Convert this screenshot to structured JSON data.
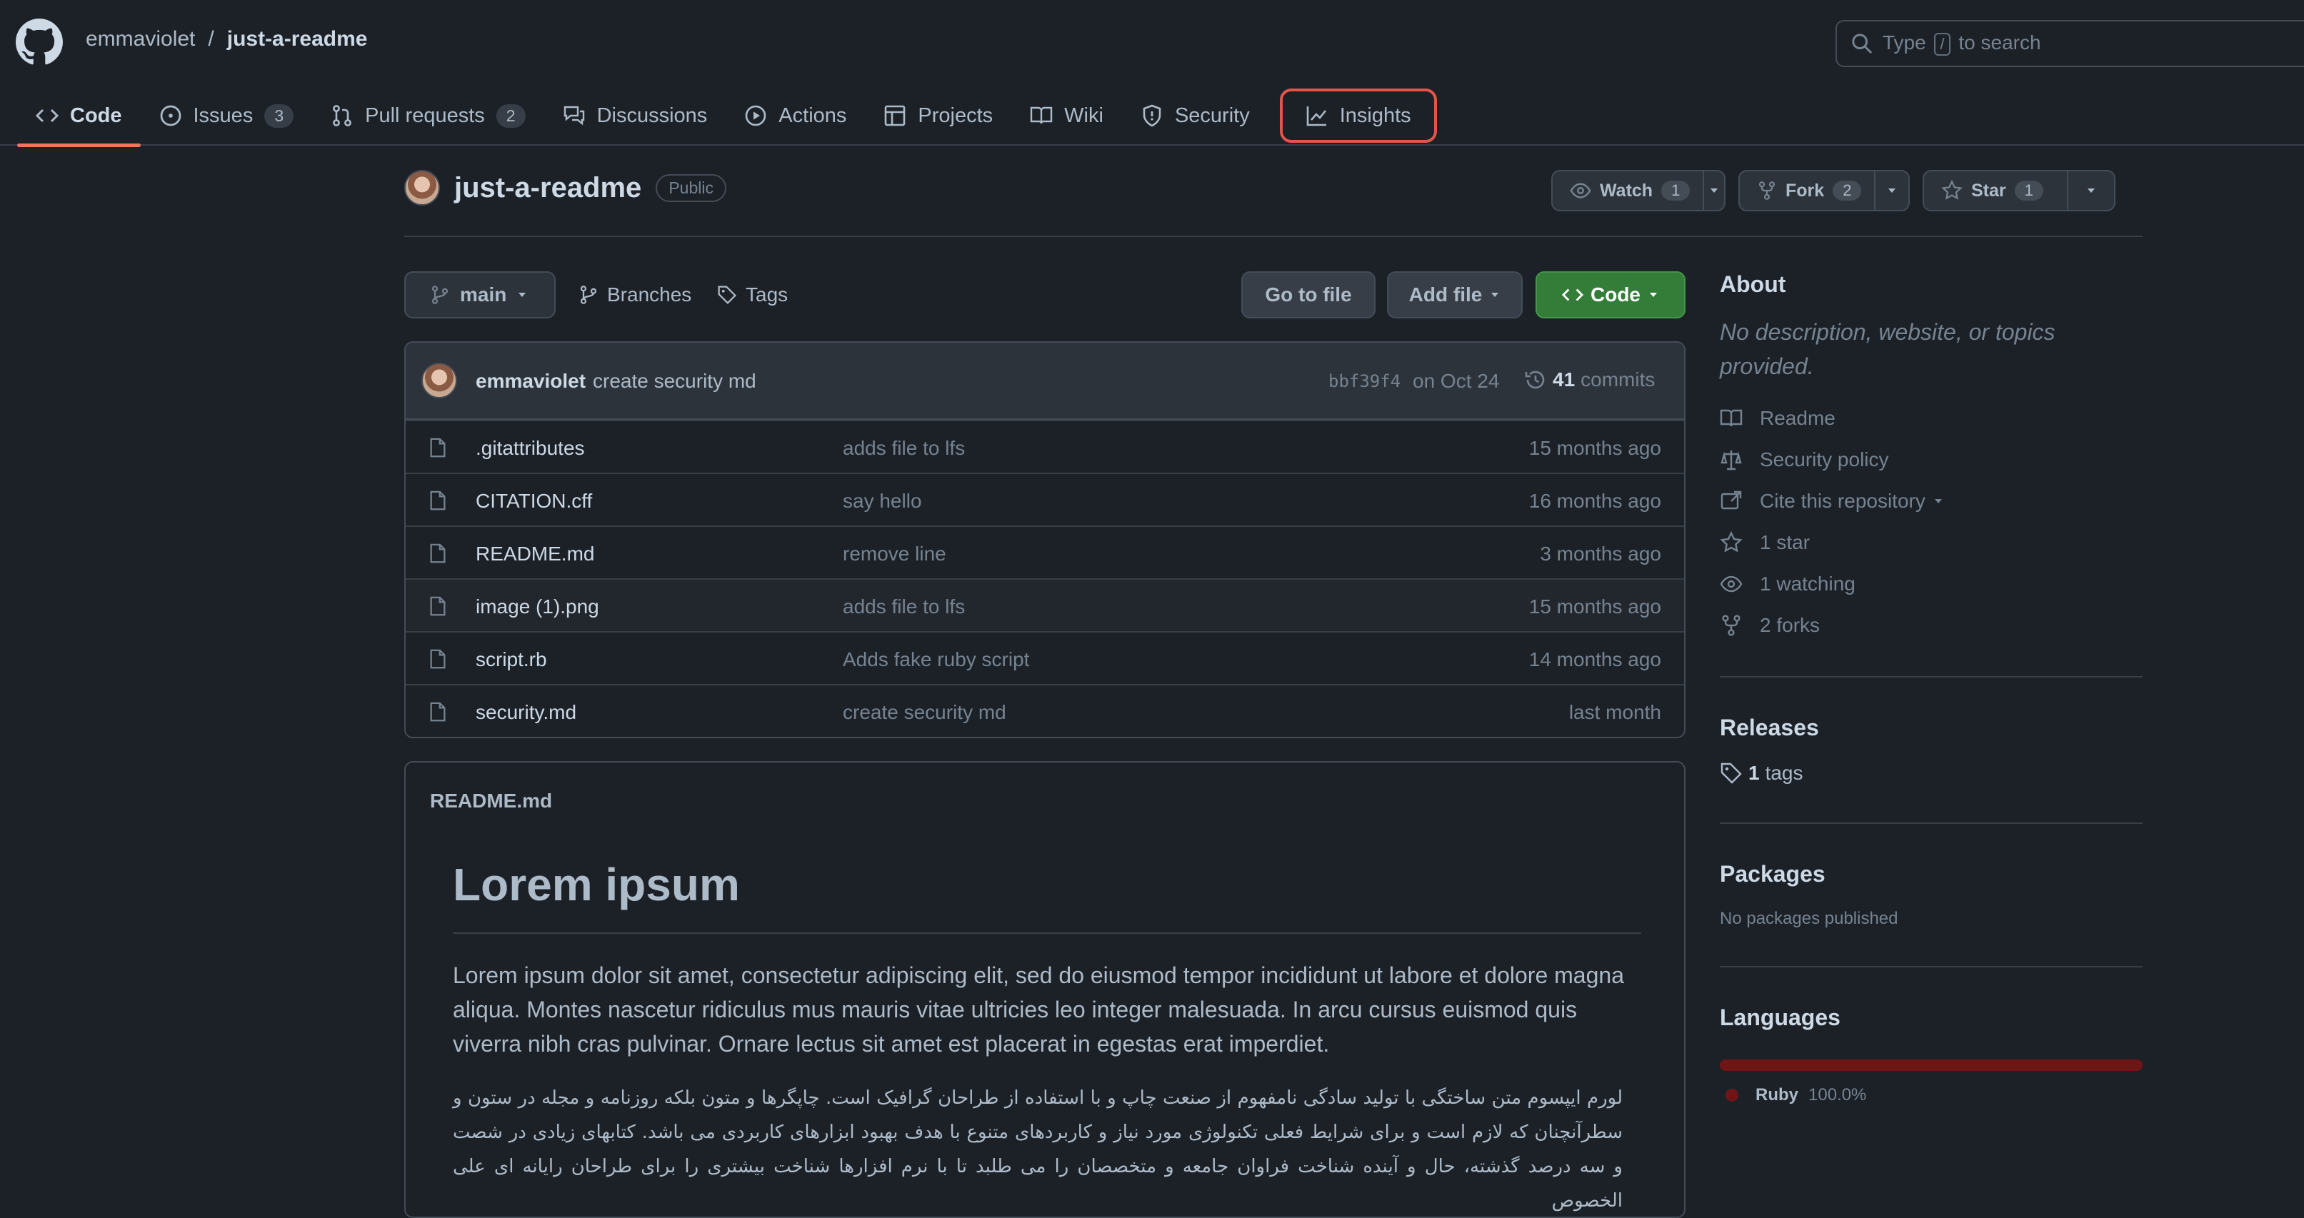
{
  "header": {
    "owner": "emmaviolet",
    "separator": "/",
    "repo": "just-a-readme",
    "search_pre": "Type",
    "search_key": "/",
    "search_post": "to search"
  },
  "tabs": [
    {
      "label": "Code",
      "icon": "code-icon"
    },
    {
      "label": "Issues",
      "count": "3",
      "icon": "issue-icon"
    },
    {
      "label": "Pull requests",
      "count": "2",
      "icon": "pull-request-icon"
    },
    {
      "label": "Discussions",
      "icon": "discussion-icon"
    },
    {
      "label": "Actions",
      "icon": "play-icon"
    },
    {
      "label": "Projects",
      "icon": "table-icon"
    },
    {
      "label": "Wiki",
      "icon": "book-icon"
    },
    {
      "label": "Security",
      "icon": "shield-icon"
    },
    {
      "label": "Insights",
      "icon": "graph-icon"
    }
  ],
  "repo_header": {
    "name": "just-a-readme",
    "visibility": "Public",
    "watch_label": "Watch",
    "watch_count": "1",
    "fork_label": "Fork",
    "fork_count": "2",
    "star_label": "Star",
    "star_count": "1"
  },
  "toolbar": {
    "branch": "main",
    "branches": "Branches",
    "tags": "Tags",
    "go_to_file": "Go to file",
    "add_file": "Add file",
    "code": "Code"
  },
  "latest_commit": {
    "author": "emmaviolet",
    "message": "create security md",
    "sha": "bbf39f4",
    "when": "on Oct 24",
    "count": "41",
    "count_label": "commits"
  },
  "files": [
    {
      "name": ".gitattributes",
      "message": "adds file to lfs",
      "age": "15 months ago"
    },
    {
      "name": "CITATION.cff",
      "message": "say hello",
      "age": "16 months ago"
    },
    {
      "name": "README.md",
      "message": "remove line",
      "age": "3 months ago"
    },
    {
      "name": "image (1).png",
      "message": "adds file to lfs",
      "age": "15 months ago"
    },
    {
      "name": "script.rb",
      "message": "Adds fake ruby script",
      "age": "14 months ago"
    },
    {
      "name": "security.md",
      "message": "create security md",
      "age": "last month"
    }
  ],
  "readme": {
    "filename": "README.md",
    "heading": "Lorem ipsum",
    "paragraph": "Lorem ipsum dolor sit amet, consectetur adipiscing elit, sed do eiusmod tempor incididunt ut labore et dolore magna aliqua. Montes nascetur ridiculus mus mauris vitae ultricies leo integer malesuada. In arcu cursus euismod quis viverra nibh cras pulvinar. Ornare lectus sit amet est placerat in egestas erat imperdiet.",
    "persian": "لورم ایپسوم متن ساختگی با تولید سادگی نامفهوم از صنعت چاپ و با استفاده از طراحان گرافیک است. چاپگرها و متون بلکه روزنامه و مجله در ستون و سطرآنچنان که لازم است و برای شرایط فعلی تکنولوژی مورد نیاز و کاربردهای متنوع با هدف بهبود ابزارهای کاربردی می باشد. کتابهای زیادی در شصت و سه درصد گذشته، حال و آینده شناخت فراوان جامعه و متخصصان را می طلبد تا با نرم افزارها شناخت بیشتری را برای طراحان رایانه ای علی الخصوص"
  },
  "about": {
    "title": "About",
    "description": "No description, website, or topics provided.",
    "items": [
      {
        "label": "Readme",
        "icon": "book-icon"
      },
      {
        "label": "Security policy",
        "icon": "law-icon"
      },
      {
        "label": "Cite this repository",
        "icon": "cite-icon"
      },
      {
        "label": "1 star",
        "icon": "star-icon"
      },
      {
        "label": "1 watching",
        "icon": "eye-icon"
      },
      {
        "label": "2 forks",
        "icon": "fork-icon"
      }
    ]
  },
  "releases": {
    "title": "Releases",
    "tags_count": "1",
    "tags_label": "tags"
  },
  "packages": {
    "title": "Packages",
    "empty": "No packages published"
  },
  "languages": {
    "title": "Languages",
    "items": [
      {
        "name": "Ruby",
        "percent": "100.0%",
        "color": "#701516"
      }
    ]
  }
}
